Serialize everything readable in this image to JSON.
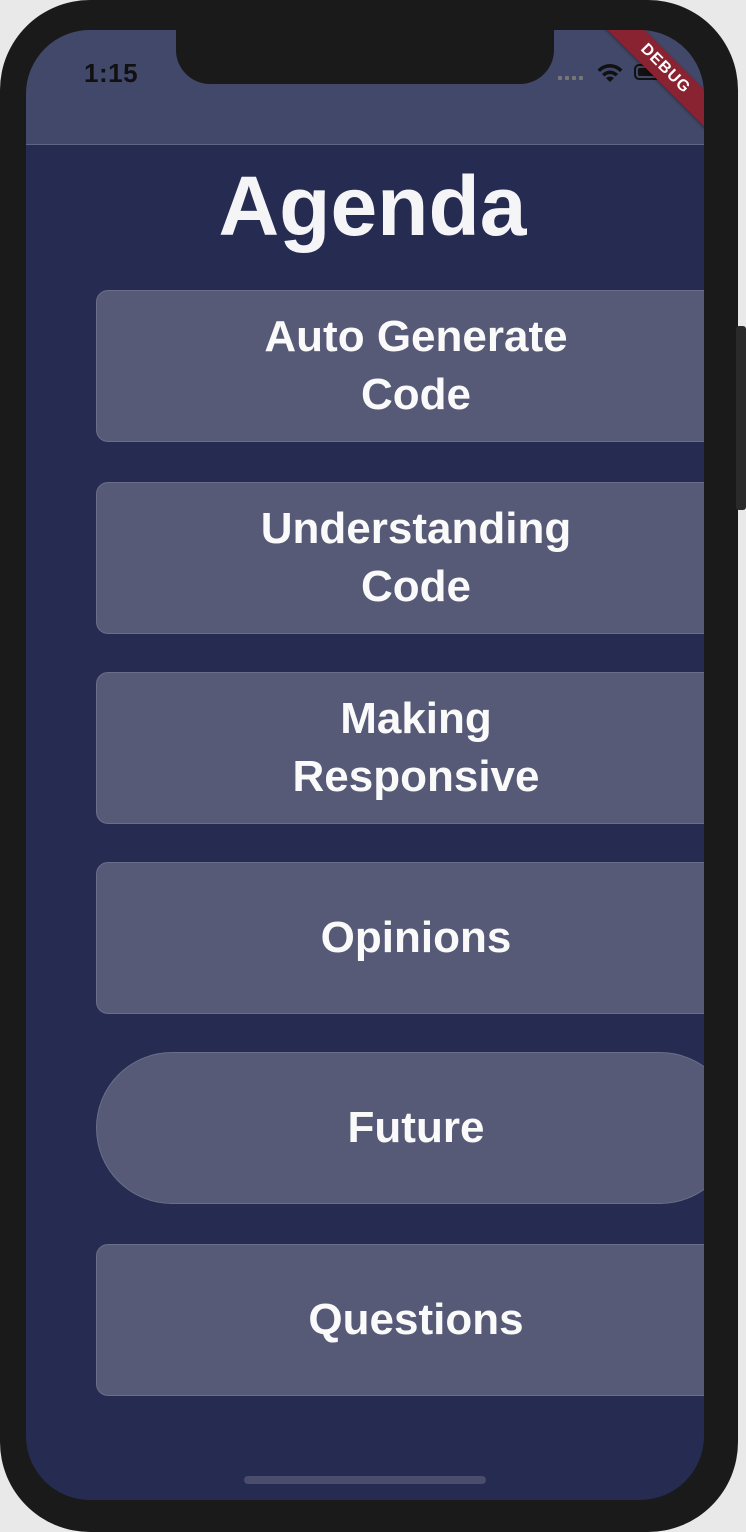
{
  "status_bar": {
    "time": "1:15",
    "debug_label": "DEBUG"
  },
  "page": {
    "title": "Agenda"
  },
  "agenda": {
    "items": [
      {
        "label": "Auto Generate Code"
      },
      {
        "label": "Understanding Code"
      },
      {
        "label": "Making Responsive"
      },
      {
        "label": "Opinions"
      },
      {
        "label": "Future"
      },
      {
        "label": "Questions"
      }
    ]
  },
  "colors": {
    "background": "#262c51",
    "app_bar": "#424869",
    "button": "#565a77",
    "debug_banner": "#8a2331",
    "text": "#fafafa"
  },
  "icons": {
    "wifi": "wifi-icon",
    "battery": "battery-icon",
    "signal": "signal-icon"
  }
}
